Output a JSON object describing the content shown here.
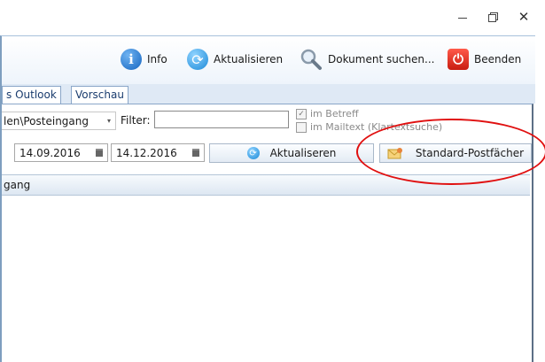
{
  "window_controls": {
    "minimize": "—",
    "maximize": "❐",
    "close": "✕"
  },
  "toolbar": {
    "info_label": "Info",
    "refresh_label": "Aktualisieren",
    "search_label": "Dokument suchen...",
    "quit_label": "Beenden"
  },
  "tabs": [
    {
      "label": "s Outlook",
      "selected": false
    },
    {
      "label": "Vorschau",
      "selected": true
    }
  ],
  "filters": {
    "folder_value": "len\\Posteingang",
    "filter_label": "Filter:",
    "filter_value": "",
    "chk_subject_label": "im Betreff",
    "chk_subject_checked": true,
    "chk_mailtext_label": "im Mailtext (Klartextsuche)",
    "chk_mailtext_checked": false,
    "date_from": "14.09.2016",
    "date_to": "14.12.2016",
    "refresh_btn": "Aktualiseren",
    "mailboxes_btn": "Standard-Postfächer"
  },
  "grid": {
    "header": "gang"
  },
  "colors": {
    "annotation": "#e01010",
    "accent": "#1d8ad8",
    "quit": "#c81c10"
  }
}
